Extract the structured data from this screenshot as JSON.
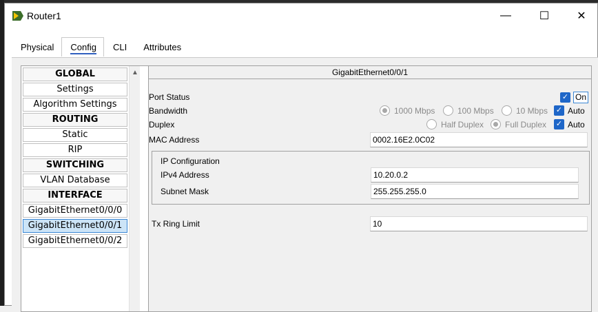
{
  "window": {
    "title": "Router1",
    "minimize_glyph": "—",
    "maximize_glyph": "☐",
    "close_glyph": "✕"
  },
  "tabs": [
    {
      "label": "Physical",
      "active": false
    },
    {
      "label": "Config",
      "active": true
    },
    {
      "label": "CLI",
      "active": false
    },
    {
      "label": "Attributes",
      "active": false
    }
  ],
  "sidebar": {
    "items": [
      {
        "label": "GLOBAL",
        "header": true
      },
      {
        "label": "Settings",
        "header": false
      },
      {
        "label": "Algorithm Settings",
        "header": false
      },
      {
        "label": "ROUTING",
        "header": true
      },
      {
        "label": "Static",
        "header": false
      },
      {
        "label": "RIP",
        "header": false
      },
      {
        "label": "SWITCHING",
        "header": true
      },
      {
        "label": "VLAN Database",
        "header": false
      },
      {
        "label": "INTERFACE",
        "header": true
      },
      {
        "label": "GigabitEthernet0/0/0",
        "header": false
      },
      {
        "label": "GigabitEthernet0/0/1",
        "header": false,
        "selected": true
      },
      {
        "label": "GigabitEthernet0/0/2",
        "header": false
      }
    ]
  },
  "interface": {
    "name": "GigabitEthernet0/0/1",
    "port_status_label": "Port Status",
    "port_status_on_label": "On",
    "bandwidth_label": "Bandwidth",
    "bandwidth_options": [
      "1000 Mbps",
      "100 Mbps",
      "10 Mbps"
    ],
    "bandwidth_auto_label": "Auto",
    "duplex_label": "Duplex",
    "duplex_options": [
      "Half Duplex",
      "Full Duplex"
    ],
    "duplex_auto_label": "Auto",
    "mac_label": "MAC Address",
    "mac_value": "0002.16E2.0C02",
    "ip_config_label": "IP Configuration",
    "ipv4_label": "IPv4 Address",
    "ipv4_value": "10.20.0.2",
    "subnet_label": "Subnet Mask",
    "subnet_value": "255.255.255.0",
    "tx_ring_label": "Tx Ring Limit",
    "tx_ring_value": "10"
  },
  "colors": {
    "accent": "#1e66c8",
    "selection": "#cce4f7"
  }
}
